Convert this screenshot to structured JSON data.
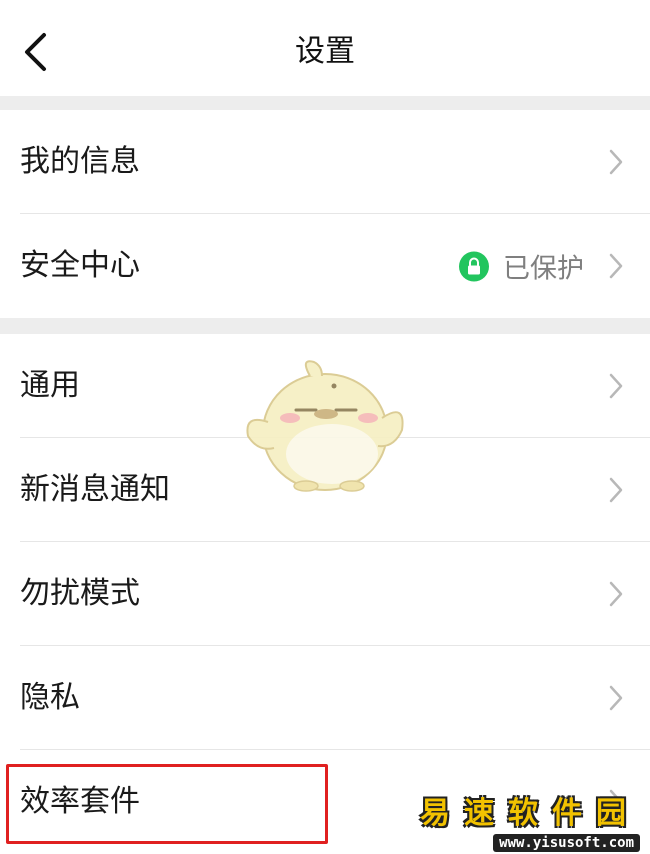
{
  "header": {
    "title": "设置"
  },
  "sections": [
    {
      "items": [
        {
          "label": "我的信息"
        },
        {
          "label": "安全中心",
          "status": "已保护"
        }
      ]
    },
    {
      "items": [
        {
          "label": "通用"
        },
        {
          "label": "新消息通知"
        },
        {
          "label": "勿扰模式"
        },
        {
          "label": "隐私"
        },
        {
          "label": "效率套件"
        }
      ]
    }
  ],
  "colors": {
    "gap": "#ededed",
    "accent_green": "#22c55e",
    "highlight_red": "#e02020",
    "chevron": "#b8b8b8"
  },
  "icons": {
    "back": "chevron-left-icon",
    "row": "chevron-right-icon",
    "lock": "lock-icon"
  },
  "watermark": {
    "title": "易速软件园",
    "url": "www.yisusoft.com"
  }
}
